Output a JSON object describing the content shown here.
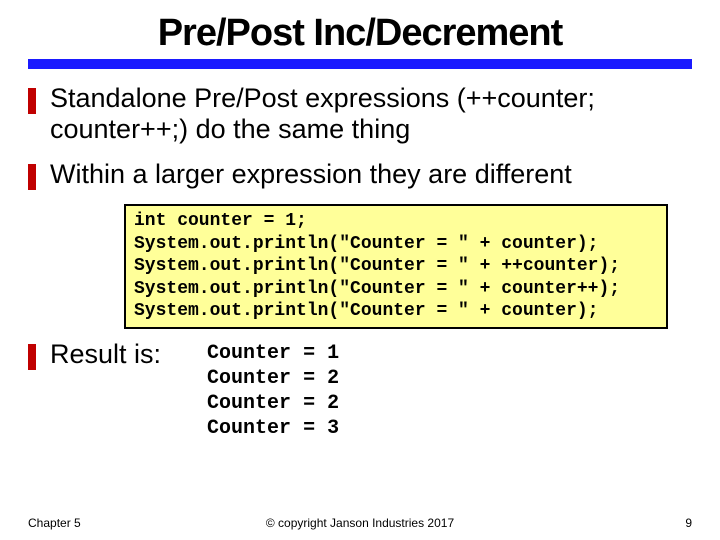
{
  "title": "Pre/Post Inc/Decrement",
  "bullets": [
    "Standalone Pre/Post expressions (++counter; counter++;) do the same thing",
    "Within a larger expression they are different"
  ],
  "code_lines": [
    "int counter = 1;",
    "System.out.println(\"Counter = \" + counter);",
    "System.out.println(\"Counter = \" + ++counter);",
    "System.out.println(\"Counter = \" + counter++);",
    "System.out.println(\"Counter = \" + counter);"
  ],
  "result_label": "Result is:",
  "output_lines": [
    "Counter = 1",
    "Counter = 2",
    "Counter = 2",
    "Counter = 3"
  ],
  "footer": {
    "left": "Chapter 5",
    "center": "© copyright Janson Industries 2017",
    "right": "9"
  }
}
